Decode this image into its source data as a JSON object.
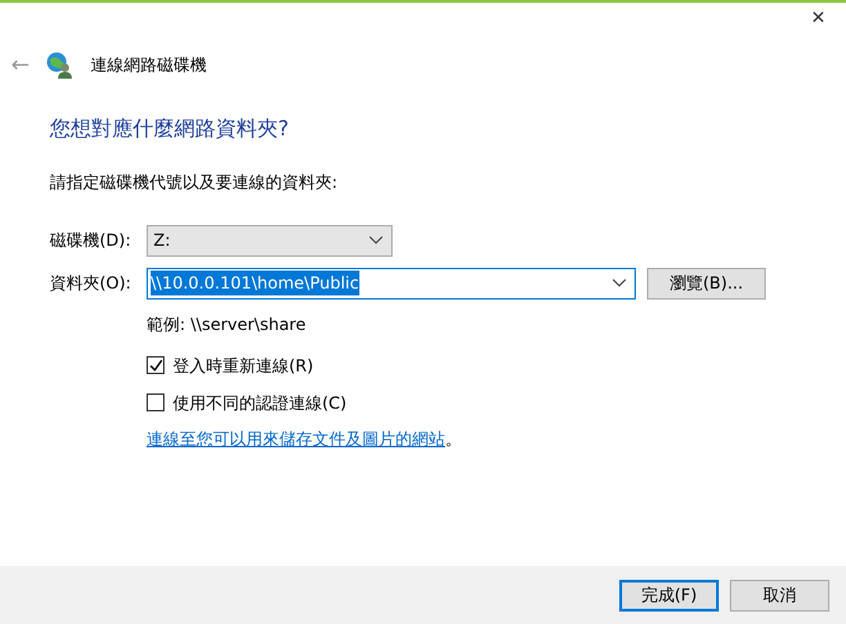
{
  "window": {
    "close": "✕"
  },
  "header": {
    "back": "←",
    "title": "連線網路磁碟機"
  },
  "heading": "您想對應什麼網路資料夾?",
  "instruction": "請指定磁碟機代號以及要連線的資料夾:",
  "drive": {
    "label": "磁碟機(D):",
    "value": "Z:"
  },
  "folder": {
    "label": "資料夾(O):",
    "value": "\\\\10.0.0.101\\home\\Public",
    "highlighted": true,
    "browse": "瀏覽(B)..."
  },
  "example": "範例: \\\\server\\share",
  "options": [
    {
      "label": "登入時重新連線(R)",
      "checked": true
    },
    {
      "label": "使用不同的認證連線(C)",
      "checked": false
    }
  ],
  "link": {
    "text": "連線至您可以用來儲存文件及圖片的網站",
    "suffix": "。"
  },
  "buttons": [
    {
      "label": "完成(F)",
      "default": true
    },
    {
      "label": "取消",
      "default": false
    }
  ]
}
